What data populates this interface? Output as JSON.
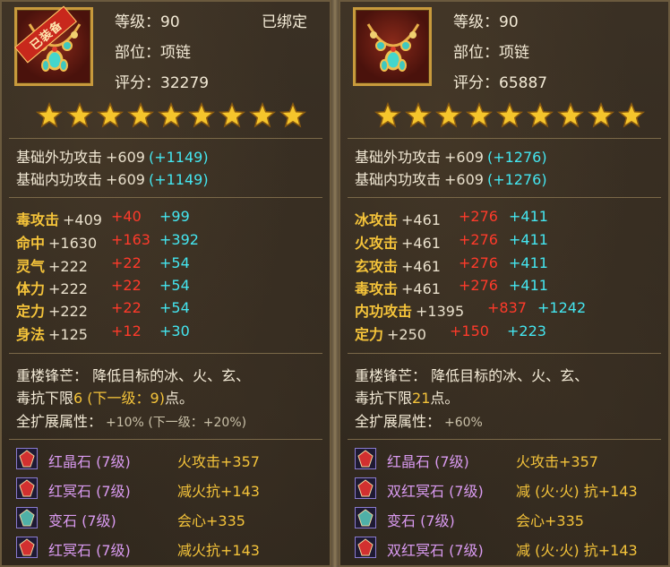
{
  "left": {
    "equipped_tag": "已装备",
    "level": "等级：90",
    "bound": "已绑定",
    "slot": "部位：项链",
    "score": "评分：32279",
    "star_count": 9,
    "base": [
      {
        "label": "基础外功攻击",
        "base": "+609",
        "bonus": "(+1149)"
      },
      {
        "label": "基础内功攻击",
        "base": "+609",
        "bonus": "(+1149)"
      }
    ],
    "attrs": [
      {
        "label": "毒攻击",
        "base": "+409",
        "red": "+40",
        "cyan": "+99"
      },
      {
        "label": "命中",
        "base": "+1630",
        "red": "+163",
        "cyan": "+392"
      },
      {
        "label": "灵气",
        "base": "+222",
        "red": "+22",
        "cyan": "+54"
      },
      {
        "label": "体力",
        "base": "+222",
        "red": "+22",
        "cyan": "+54"
      },
      {
        "label": "定力",
        "base": "+222",
        "red": "+22",
        "cyan": "+54"
      },
      {
        "label": "身法",
        "base": "+125",
        "red": "+12",
        "cyan": "+30"
      }
    ],
    "skill_line1": "重楼锋芒： 降低目标的冰、火、玄、",
    "skill_line2_a": "毒抗下限",
    "skill_line2_b": "6 (下一级：9)",
    "skill_line2_c": "点。",
    "expand_label": "全扩展属性：",
    "expand_value": "+10% (下一级：+20%)",
    "sockets": [
      {
        "icon": "red-crystal-gem-icon",
        "name": "红晶石 (7级)",
        "effect": "火攻击+357"
      },
      {
        "icon": "red-ming-gem-icon",
        "name": "红冥石 (7级)",
        "effect": "减火抗+143"
      },
      {
        "icon": "bian-stone-icon",
        "name": "变石 (7级)",
        "effect": "会心+335"
      },
      {
        "icon": "red-ming-gem-icon",
        "name": "红冥石 (7级)",
        "effect": "减火抗+143"
      }
    ]
  },
  "right": {
    "level": "等级：90",
    "slot": "部位：项链",
    "score": "评分：65887",
    "star_count": 9,
    "base": [
      {
        "label": "基础外功攻击",
        "base": "+609",
        "bonus": "(+1276)"
      },
      {
        "label": "基础内功攻击",
        "base": "+609",
        "bonus": "(+1276)"
      }
    ],
    "attrs": [
      {
        "label": "冰攻击",
        "base": "+461",
        "red": "+276",
        "cyan": "+411"
      },
      {
        "label": "火攻击",
        "base": "+461",
        "red": "+276",
        "cyan": "+411"
      },
      {
        "label": "玄攻击",
        "base": "+461",
        "red": "+276",
        "cyan": "+411"
      },
      {
        "label": "毒攻击",
        "base": "+461",
        "red": "+276",
        "cyan": "+411"
      },
      {
        "label": "内功攻击",
        "base": "+1395",
        "red": "+837",
        "cyan": "+1242"
      },
      {
        "label": "定力",
        "base": "+250",
        "red": "+150",
        "cyan": "+223"
      }
    ],
    "skill_line1": "重楼锋芒： 降低目标的冰、火、玄、",
    "skill_line2_a": "毒抗下限",
    "skill_line2_b": "21",
    "skill_line2_c": "点。",
    "expand_label": "全扩展属性：",
    "expand_value": "+60%",
    "sockets": [
      {
        "icon": "red-crystal-gem-icon",
        "name": "红晶石 (7级)",
        "effect": "火攻击+357"
      },
      {
        "icon": "double-red-ming-gem-icon",
        "name": "双红冥石 (7级)",
        "effect": "减 (火·火) 抗+143"
      },
      {
        "icon": "bian-stone-icon",
        "name": "变石 (7级)",
        "effect": "会心+335"
      },
      {
        "icon": "double-red-ming-gem-icon",
        "name": "双红冥石 (7级)",
        "effect": "减 (火·火) 抗+143"
      }
    ]
  },
  "colors": {
    "label_gold": "#f4c33a",
    "value_red": "#ff3a2a",
    "value_cyan": "#44e6f0",
    "socket_purple": "#d99af0"
  }
}
